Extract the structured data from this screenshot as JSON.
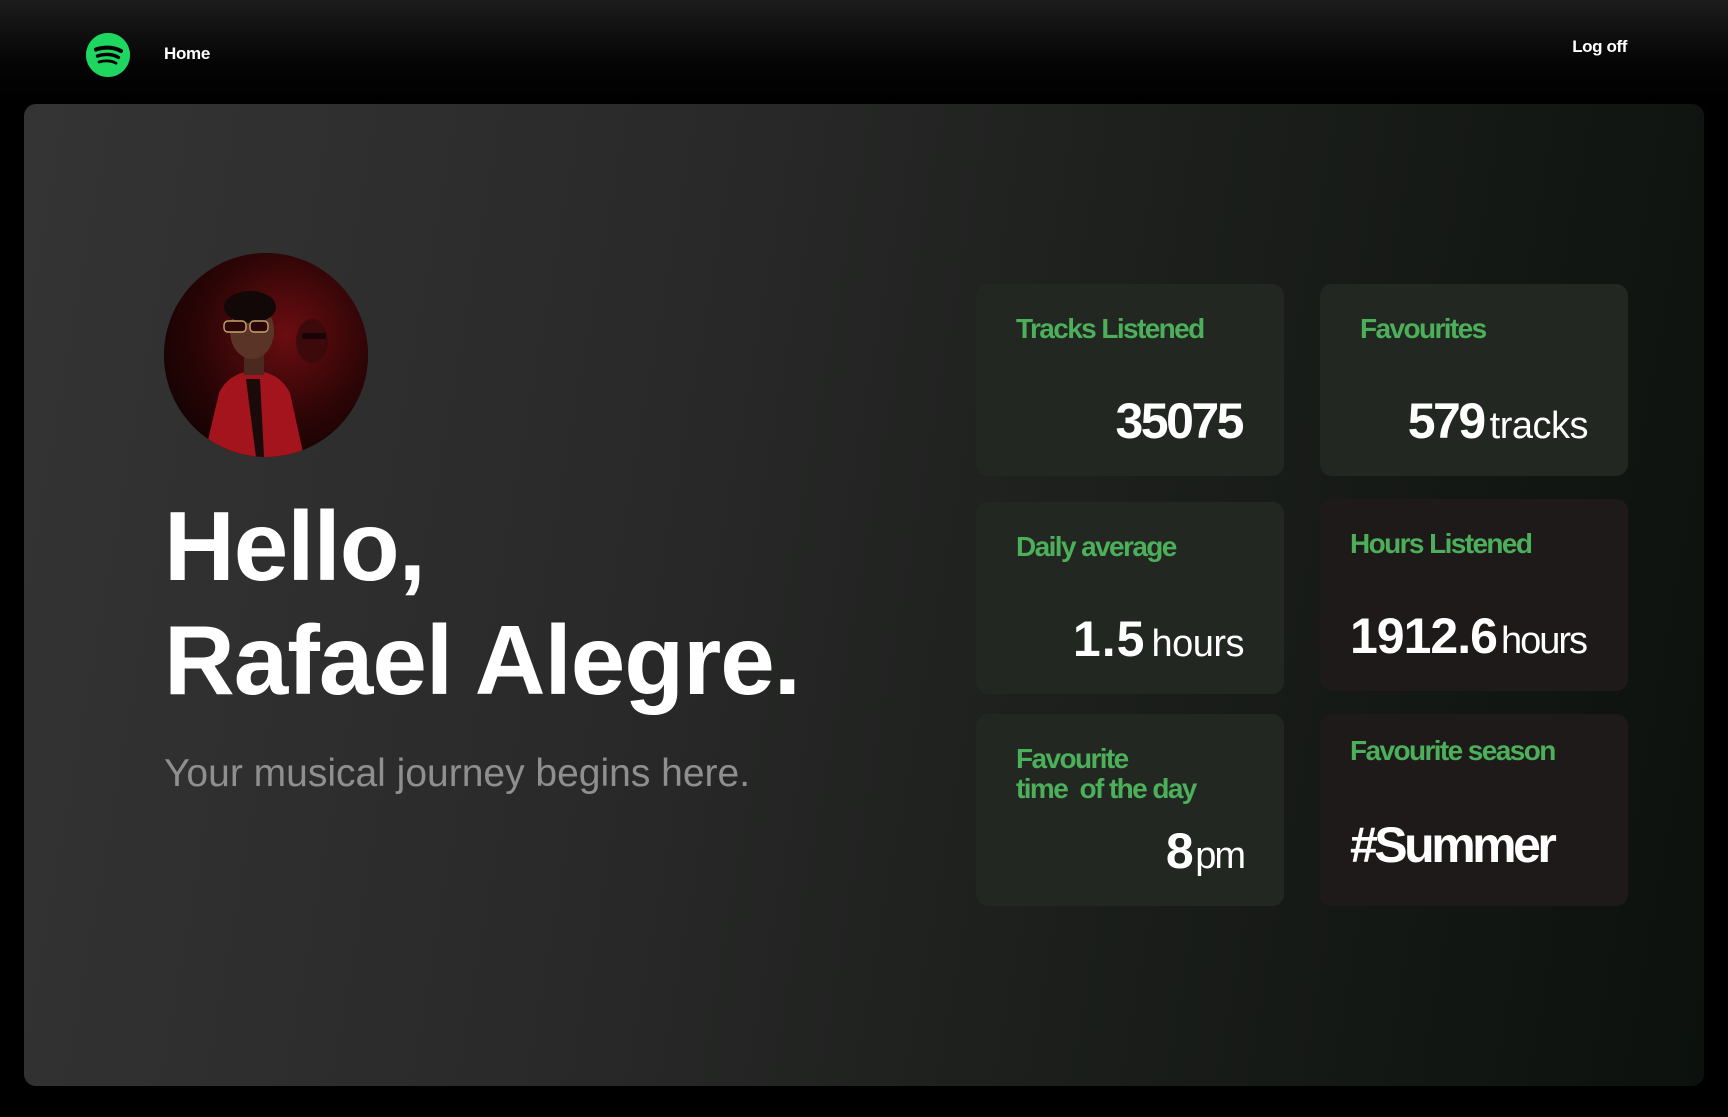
{
  "nav": {
    "logo_icon": "spotify-logo-icon",
    "home_label": "Home",
    "logoff_label": "Log off"
  },
  "hero": {
    "greeting_line1": "Hello,",
    "greeting_line2": "Rafael Alegre.",
    "subtitle": "Your musical journey begins here."
  },
  "stats": {
    "tracks_listened": {
      "label": "Tracks Listened",
      "value": "35075"
    },
    "favourites": {
      "label": "Favourites",
      "value": "579",
      "unit": "tracks"
    },
    "daily_average": {
      "label": "Daily average",
      "value": "1.5",
      "unit": "hours"
    },
    "hours_listened": {
      "label": "Hours Listened",
      "value": "1912.6",
      "unit": "hours"
    },
    "favourite_time": {
      "label_line1": "Favourite",
      "label_line2": "time  of the day",
      "value": "8",
      "unit": "pm"
    },
    "favourite_season": {
      "label": "Favourite season",
      "value": "#Summer"
    }
  },
  "colors": {
    "brand_green": "#1ed760",
    "label_green": "#4caf5a",
    "card_bg": "#222722",
    "card_dark_bg": "#1e1a1a"
  }
}
